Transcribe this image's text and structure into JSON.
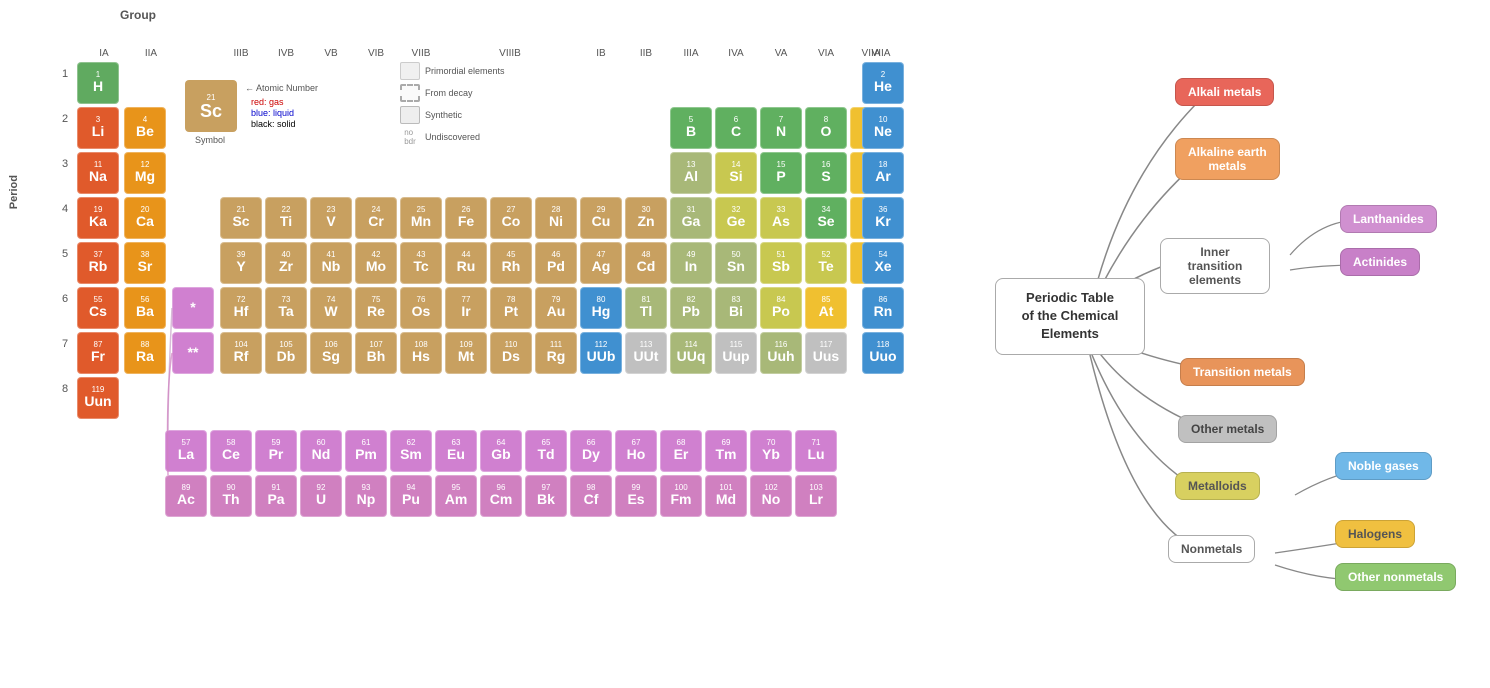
{
  "labels": {
    "group": "Group",
    "period": "Period",
    "ia": "IA",
    "iia": "IIA",
    "iiib": "IIIB",
    "ivb": "IVB",
    "vb": "VB",
    "vib": "VIB",
    "viib": "VIIB",
    "viiib": "VIIIB",
    "ib": "IB",
    "iib": "IIB",
    "iiia": "IIIA",
    "iva": "IVA",
    "va": "VA",
    "via": "VIA",
    "viia": "VIIA",
    "viia2": "VIIA"
  },
  "legend": {
    "primordial": "Primordial elements",
    "from_decay": "From decay",
    "synthetic": "Synthetic",
    "undiscovered": "Undiscovered"
  },
  "example": {
    "num": "21",
    "sym": "Sc",
    "label": "Symbol",
    "atomic_number_label": "Atomic Number",
    "colors_label": "red: gas\nblue: liquid\nblack: solid"
  },
  "center_node": {
    "text": "Periodic Table\nof the Chemical\nElements"
  },
  "nodes": {
    "alkali": {
      "label": "Alkali metals",
      "color": "#e8665a",
      "text": "#fff"
    },
    "alkaline": {
      "label": "Alkaline earth\nmetals",
      "color": "#f0a060",
      "text": "#fff"
    },
    "inner_transition": {
      "label": "Inner transition\nelements",
      "color": "#fff",
      "text": "#555",
      "border": "#aaa"
    },
    "lanthanides": {
      "label": "Lanthanides",
      "color": "#d090d0",
      "text": "#fff"
    },
    "actinides": {
      "label": "Actinides",
      "color": "#c880c8",
      "text": "#fff"
    },
    "transition": {
      "label": "Transition metals",
      "color": "#e8945a",
      "text": "#fff"
    },
    "other_metals": {
      "label": "Other metals",
      "color": "#c0c0c0",
      "text": "#555"
    },
    "metalloids": {
      "label": "Metalloids",
      "color": "#d0c870",
      "text": "#555"
    },
    "noble_gases": {
      "label": "Noble gases",
      "color": "#70b8e8",
      "text": "#fff"
    },
    "nonmetals": {
      "label": "Nonmetals",
      "color": "#fff",
      "text": "#555",
      "border": "#aaa"
    },
    "halogens": {
      "label": "Halogens",
      "color": "#f0c040",
      "text": "#555"
    },
    "other_nonmetals": {
      "label": "Other nonmetals",
      "color": "#90c870",
      "text": "#fff"
    }
  }
}
